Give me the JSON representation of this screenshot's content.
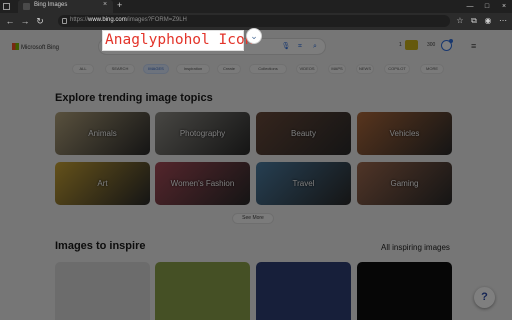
{
  "browser": {
    "tab_title": "Bing Images",
    "tab_close": "×",
    "new_tab": "+",
    "url_prefix": "https://",
    "url_domain": "www.bing.com",
    "url_path": "/images?FORM=Z9LH",
    "window_controls": [
      "—",
      "□",
      "×"
    ]
  },
  "header": {
    "logo_text": "Microsoft Bing",
    "points": "300",
    "reward_badge": "1"
  },
  "chips": [
    {
      "label": "ALL",
      "active": false
    },
    {
      "label": "SEARCH",
      "active": false
    },
    {
      "label": "IMAGES",
      "active": true
    },
    {
      "label": "Inspiration",
      "active": false
    },
    {
      "label": "Create",
      "active": false
    },
    {
      "label": "Collections",
      "active": false
    },
    {
      "label": "VIDEOS",
      "active": false
    },
    {
      "label": "MAPS",
      "active": false
    },
    {
      "label": "NEWS",
      "active": false
    },
    {
      "label": "COPILOT",
      "active": false
    },
    {
      "label": "MORE",
      "active": false
    }
  ],
  "trending": {
    "title": "Explore trending image topics",
    "tiles": [
      {
        "label": "Animals",
        "color": "#b2a27c"
      },
      {
        "label": "Photography",
        "color": "#8f8d86"
      },
      {
        "label": "Beauty",
        "color": "#6a4a3a"
      },
      {
        "label": "Vehicles",
        "color": "#b06a3c"
      },
      {
        "label": "Art",
        "color": "#c9a335"
      },
      {
        "label": "Women's Fashion",
        "color": "#a84b58"
      },
      {
        "label": "Travel",
        "color": "#4c7ea4"
      },
      {
        "label": "Gaming",
        "color": "#a06a4f"
      }
    ],
    "see_more": "See More"
  },
  "inspire": {
    "title": "Images to inspire",
    "all_link": "All inspiring images",
    "tiles": [
      {
        "color": "#d8d8d8"
      },
      {
        "color": "#8aa04a"
      },
      {
        "color": "#2e3e74"
      },
      {
        "color": "#0d0d0d"
      }
    ]
  },
  "help_label": "?",
  "tooltip": {
    "text": "Anaglyphohol Icon"
  }
}
